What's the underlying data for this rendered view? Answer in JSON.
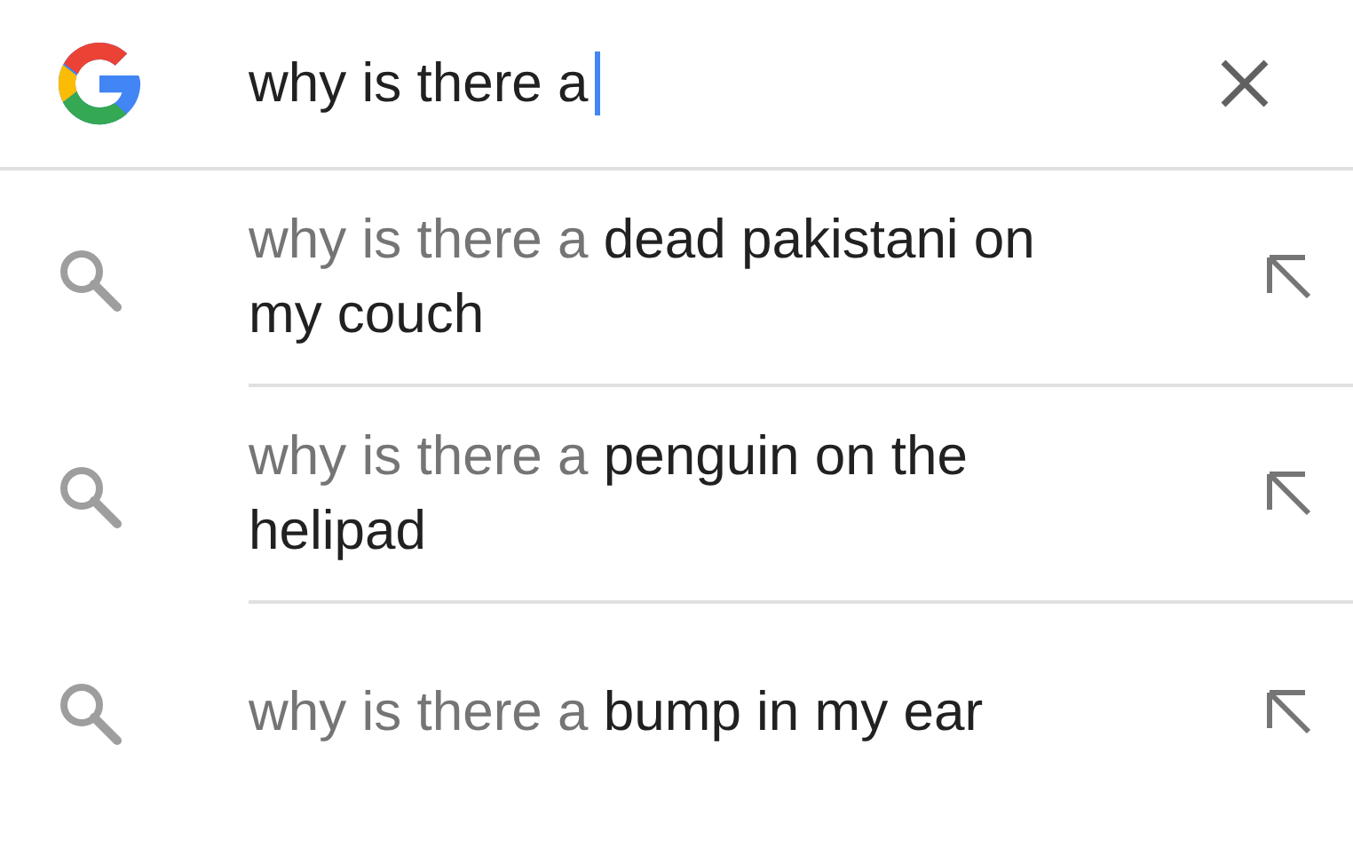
{
  "search": {
    "value": "why is there a"
  },
  "suggestions": [
    {
      "prefix": "why is there a",
      "completion": "dead pakistani on my couch"
    },
    {
      "prefix": "why is there a",
      "completion": "penguin on the helipad"
    },
    {
      "prefix": "why is there a",
      "completion": "bump in my ear"
    }
  ]
}
